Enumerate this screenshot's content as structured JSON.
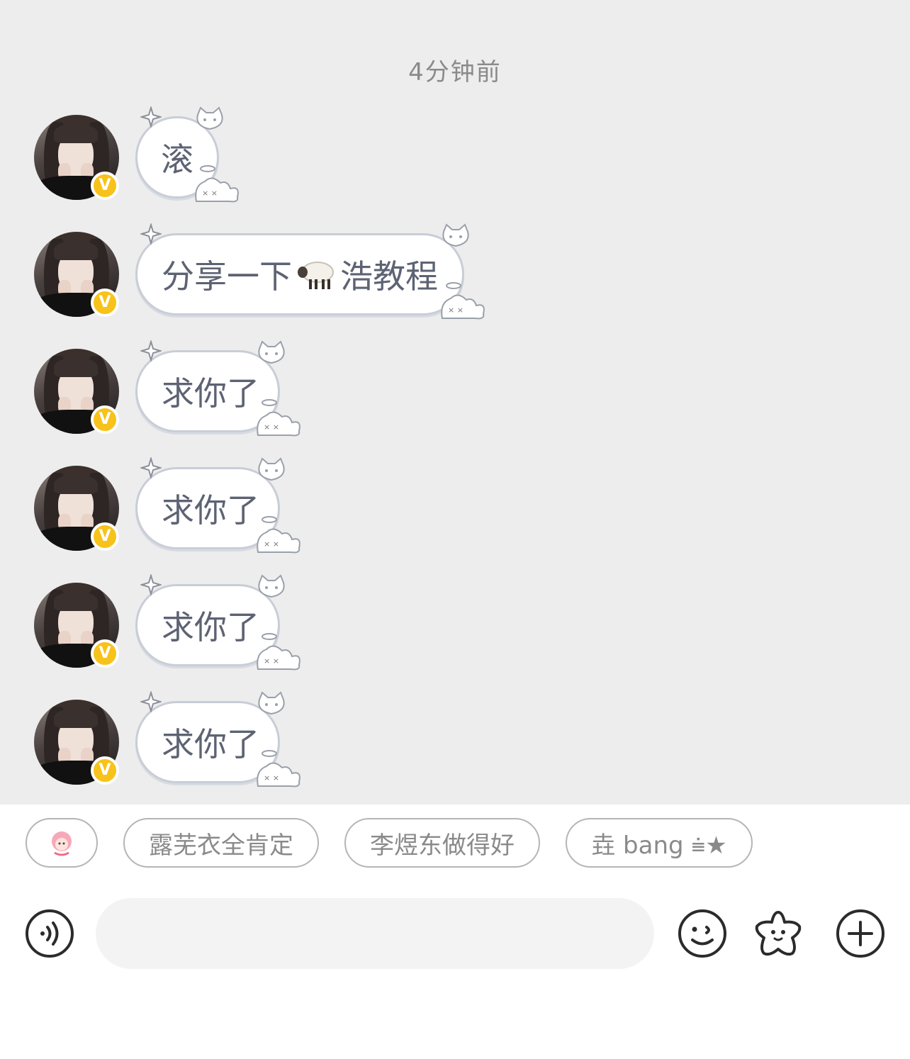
{
  "timestamp": "4分钟前",
  "messages": [
    {
      "text": "滚"
    },
    {
      "text_before": "分享一下",
      "emoji": "sheep",
      "text_after": "浩教程"
    },
    {
      "text": "求你了"
    },
    {
      "text": "求你了"
    },
    {
      "text": "求你了"
    },
    {
      "text": "求你了"
    }
  ],
  "avatar_badge": "V",
  "quick_replies": [
    {
      "label": "",
      "icon": "pink-sticker-icon"
    },
    {
      "label": "露芜衣全肯定"
    },
    {
      "label": "李煜东做得好"
    },
    {
      "label": "垚 bang ⩧★"
    }
  ],
  "input": {
    "placeholder": "",
    "value": ""
  },
  "colors": {
    "badge": "#f7c21a",
    "bubble_border": "#c9cdd6",
    "chat_bg": "#ededed",
    "text": "#5d6373"
  },
  "icons": [
    "voice-icon",
    "emoji-icon",
    "sticker-star-icon",
    "plus-icon"
  ]
}
